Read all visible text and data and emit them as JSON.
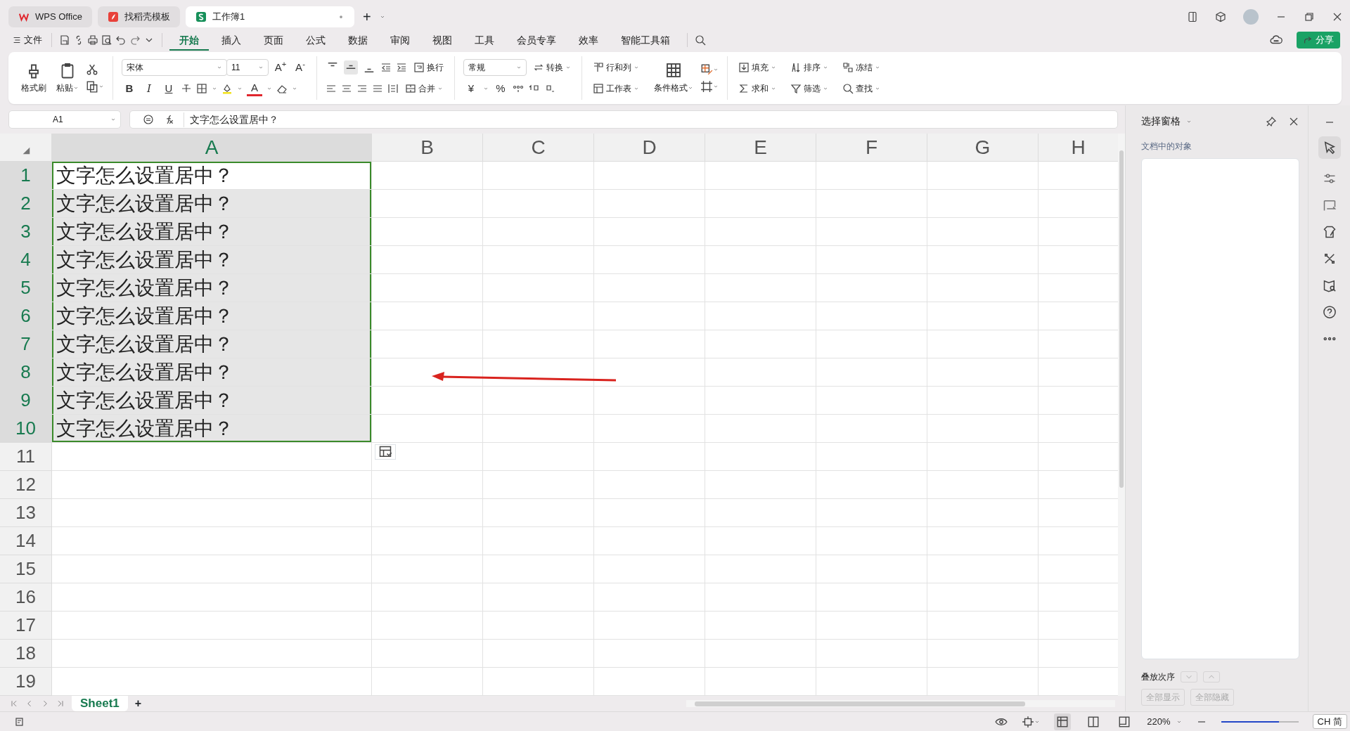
{
  "title_tabs": [
    {
      "label": "WPS Office",
      "selected": false
    },
    {
      "label": "找稻壳模板",
      "selected": false
    },
    {
      "label": "工作簿1",
      "selected": true
    }
  ],
  "new_tab": "+",
  "menu": {
    "file": "文件",
    "tabs": [
      {
        "label": "开始",
        "selected": true
      },
      {
        "label": "插入",
        "selected": false
      },
      {
        "label": "页面",
        "selected": false
      },
      {
        "label": "公式",
        "selected": false
      },
      {
        "label": "数据",
        "selected": false
      },
      {
        "label": "审阅",
        "selected": false
      },
      {
        "label": "视图",
        "selected": false
      },
      {
        "label": "工具",
        "selected": false
      },
      {
        "label": "会员专享",
        "selected": false
      },
      {
        "label": "效率",
        "selected": false
      },
      {
        "label": "智能工具箱",
        "selected": false
      }
    ],
    "share": "分享"
  },
  "ribbon": {
    "format_painter": "格式刷",
    "paste": "粘贴",
    "font_name": "宋体",
    "font_size": "11",
    "grow_font": "A$^{+}$",
    "shrink_font": "A$^{-}$",
    "bold": "B",
    "italic": "I",
    "underline": "U",
    "font_color": "A",
    "vertical_align": [
      {
        "selected": false
      },
      {
        "selected": true
      },
      {
        "selected": false
      }
    ],
    "wrap_text": "换行",
    "merge": "合并",
    "number_format": "常规",
    "convert": "转换",
    "currency": "¥",
    "percent": "%",
    "rows_columns": "行和列",
    "worksheet": "工作表",
    "conditional_format": "条件格式",
    "editing": [
      {
        "label": "填充"
      },
      {
        "label": "排序"
      },
      {
        "label": "冻结"
      },
      {
        "label": "求和"
      },
      {
        "label": "筛选"
      },
      {
        "label": "查找"
      }
    ]
  },
  "formula_bar": {
    "cell_ref": "A1",
    "formula": "文字怎么设置居中？"
  },
  "sheet": {
    "columns": [
      {
        "label": "A",
        "selected": true
      },
      {
        "label": "B",
        "selected": false
      },
      {
        "label": "C",
        "selected": false
      },
      {
        "label": "D",
        "selected": false
      },
      {
        "label": "E",
        "selected": false
      },
      {
        "label": "F",
        "selected": false
      },
      {
        "label": "G",
        "selected": false
      },
      {
        "label": "H",
        "selected": false
      }
    ],
    "rows": [
      {
        "number": "1",
        "selected": true,
        "cells": [
          "文字怎么设置居中？"
        ]
      },
      {
        "number": "2",
        "selected": true,
        "cells": [
          "文字怎么设置居中？"
        ]
      },
      {
        "number": "3",
        "selected": true,
        "cells": [
          "文字怎么设置居中？"
        ]
      },
      {
        "number": "4",
        "selected": true,
        "cells": [
          "文字怎么设置居中？"
        ]
      },
      {
        "number": "5",
        "selected": true,
        "cells": [
          "文字怎么设置居中？"
        ]
      },
      {
        "number": "6",
        "selected": true,
        "cells": [
          "文字怎么设置居中？"
        ]
      },
      {
        "number": "7",
        "selected": true,
        "cells": [
          "文字怎么设置居中？"
        ]
      },
      {
        "number": "8",
        "selected": true,
        "cells": [
          "文字怎么设置居中？"
        ]
      },
      {
        "number": "9",
        "selected": true,
        "cells": [
          "文字怎么设置居中？"
        ]
      },
      {
        "number": "10",
        "selected": true,
        "cells": [
          "文字怎么设置居中？"
        ]
      },
      {
        "number": "11",
        "selected": false
      },
      {
        "number": "12",
        "selected": false
      },
      {
        "number": "13",
        "selected": false
      },
      {
        "number": "14",
        "selected": false
      },
      {
        "number": "15",
        "selected": false
      },
      {
        "number": "16",
        "selected": false
      },
      {
        "number": "17",
        "selected": false
      },
      {
        "number": "18",
        "selected": false
      },
      {
        "number": "19",
        "selected": false
      }
    ]
  },
  "sheet_tabs": [
    {
      "label": "Sheet1",
      "selected": true
    }
  ],
  "add_sheet": "+",
  "selection_pane": {
    "title": "选择窗格",
    "subtitle": "文档中的对象",
    "order_label": "叠放次序",
    "order_buttons": [
      {
        "disabled": true
      },
      {
        "disabled": true
      }
    ],
    "buttons": [
      {
        "label": "全部显示",
        "disabled": true
      },
      {
        "label": "全部隐藏",
        "disabled": true
      }
    ]
  },
  "status_bar": {
    "zoom": "220%",
    "zoom_slider": {
      "level": 0.75
    },
    "views": [
      {
        "selected": true
      },
      {
        "selected": false
      },
      {
        "selected": false
      }
    ],
    "ime": "CH 简"
  }
}
